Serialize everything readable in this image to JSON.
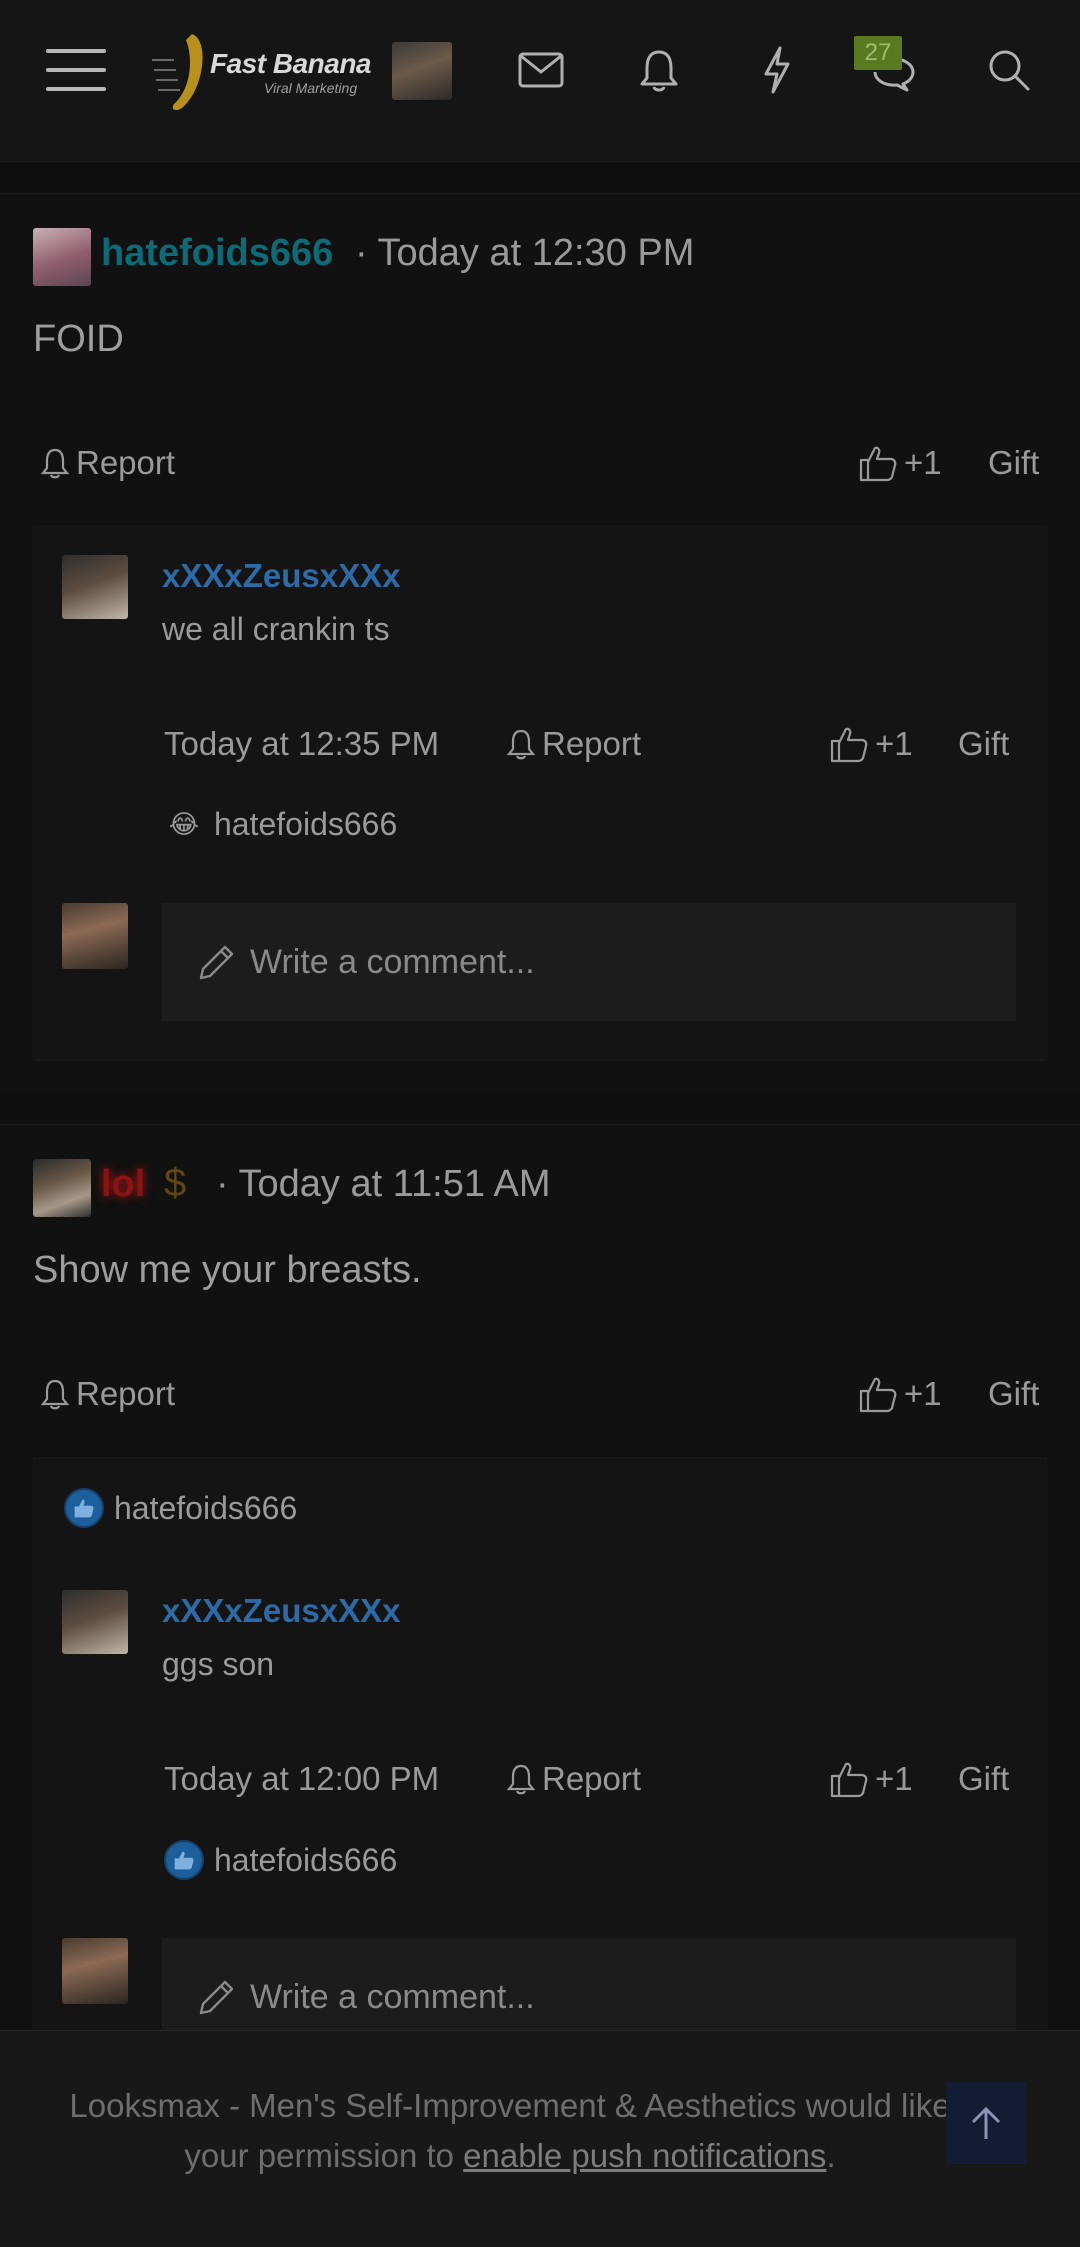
{
  "header": {
    "logo_title": "Fast Banana",
    "logo_subtitle": "Viral Marketing",
    "chat_count": "27"
  },
  "posts": [
    {
      "username": "hatefoids666",
      "time": "· Today at 12:30 PM",
      "text": "FOID",
      "report": "Report",
      "like": "+1",
      "gift": "Gift",
      "comments": [
        {
          "username": "xXXxZeusxXXx",
          "text": "we all crankin ts",
          "time": "Today at 12:35 PM",
          "report": "Report",
          "like": "+1",
          "gift": "Gift",
          "reaction_user": "hatefoids666",
          "reaction_emoji": "😂"
        }
      ],
      "write_placeholder": "Write a comment..."
    },
    {
      "username": "lol",
      "time": "· Today at 11:51 AM",
      "text": "Show me your breasts.",
      "report": "Report",
      "like": "+1",
      "gift": "Gift",
      "reaction_user": "hatefoids666",
      "comments": [
        {
          "username": "xXXxZeusxXXx",
          "text": "ggs son",
          "time": "Today at 12:00 PM",
          "report": "Report",
          "like": "+1",
          "gift": "Gift",
          "reaction_user": "hatefoids666"
        }
      ],
      "write_placeholder": "Write a comment..."
    }
  ],
  "push_banner": {
    "text_before": "Looksmax - Men's Self-Improvement & Aesthetics would like your permission to ",
    "link": "enable push notifications",
    "text_after": "."
  },
  "icons": [
    "menu-icon",
    "envelope-icon",
    "bell-icon",
    "lightning-icon",
    "chat-icon",
    "search-icon",
    "thumbs-up-icon",
    "pencil-icon",
    "close-icon",
    "arrow-up-icon"
  ]
}
